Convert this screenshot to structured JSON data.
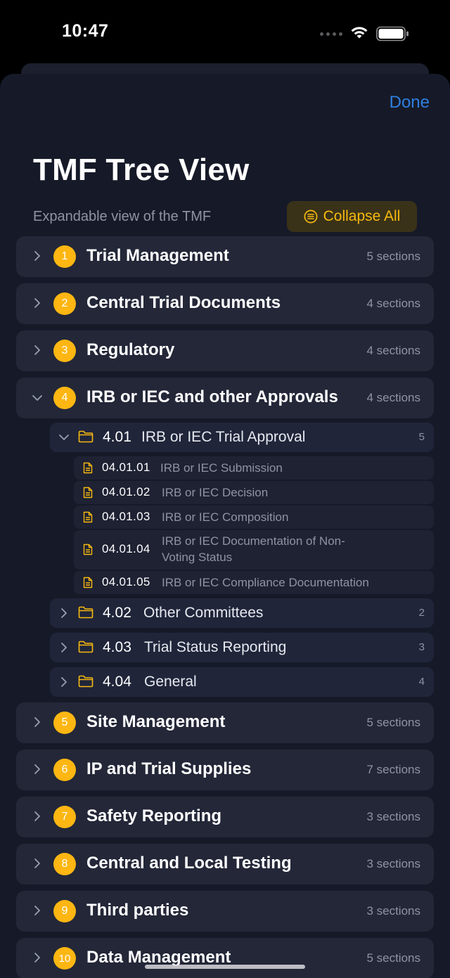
{
  "status_bar": {
    "time": "10:47"
  },
  "header": {
    "done_label": "Done",
    "title": "TMF Tree View",
    "subtitle": "Expandable view of the TMF",
    "collapse_all_label": "Collapse All"
  },
  "colors": {
    "accent": "#fdb612",
    "link": "#2e7fe0",
    "background": "#161a28",
    "card": "#232738"
  },
  "categories": [
    {
      "number": "1",
      "name": "Trial Management",
      "count": "5 sections",
      "expanded": false
    },
    {
      "number": "2",
      "name": "Central Trial Documents",
      "count": "4 sections",
      "expanded": false
    },
    {
      "number": "3",
      "name": "Regulatory",
      "count": "4 sections",
      "expanded": false
    },
    {
      "number": "4",
      "name": "IRB or IEC and other Approvals",
      "count": "4 sections",
      "expanded": true,
      "sections": [
        {
          "code": "4.01",
          "name": "IRB or IEC Trial Approval",
          "count": "5",
          "expanded": true,
          "documents": [
            {
              "code": "04.01.01",
              "name": "IRB or IEC Submission"
            },
            {
              "code": "04.01.02",
              "name": "IRB or IEC Decision"
            },
            {
              "code": "04.01.03",
              "name": "IRB or IEC Composition"
            },
            {
              "code": "04.01.04",
              "name": "IRB or IEC Documentation of Non-Voting Status"
            },
            {
              "code": "04.01.05",
              "name": "IRB or IEC Compliance Documentation"
            }
          ]
        },
        {
          "code": "4.02",
          "name": "Other Committees",
          "count": "2",
          "expanded": false
        },
        {
          "code": "4.03",
          "name": "Trial Status Reporting",
          "count": "3",
          "expanded": false
        },
        {
          "code": "4.04",
          "name": "General",
          "count": "4",
          "expanded": false
        }
      ]
    },
    {
      "number": "5",
      "name": "Site Management",
      "count": "5 sections",
      "expanded": false
    },
    {
      "number": "6",
      "name": "IP and Trial Supplies",
      "count": "7 sections",
      "expanded": false
    },
    {
      "number": "7",
      "name": "Safety Reporting",
      "count": "3 sections",
      "expanded": false
    },
    {
      "number": "8",
      "name": "Central and Local Testing",
      "count": "3 sections",
      "expanded": false
    },
    {
      "number": "9",
      "name": "Third parties",
      "count": "3 sections",
      "expanded": false
    },
    {
      "number": "10",
      "name": "Data Management",
      "count": "5 sections",
      "expanded": false
    }
  ]
}
